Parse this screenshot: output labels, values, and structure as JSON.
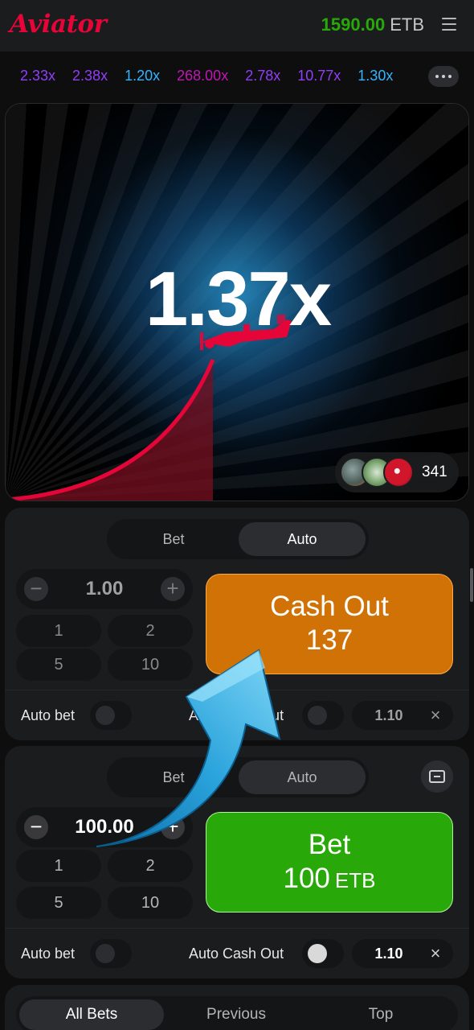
{
  "app": {
    "logo": "Aviator",
    "balance_amount": "1590.00",
    "balance_currency": "ETB"
  },
  "history": [
    "2.33x",
    "2.38x",
    "1.20x",
    "268.00x",
    "2.78x",
    "10.77x",
    "1.30x"
  ],
  "history_colors": [
    "#913ef8",
    "#913ef8",
    "#34b4ff",
    "#c017b4",
    "#913ef8",
    "#913ef8",
    "#34b4ff"
  ],
  "game": {
    "multiplier": "1.37x",
    "players_count": "341"
  },
  "panel1": {
    "tabs": [
      "Bet",
      "Auto"
    ],
    "active_tab": "Auto",
    "stake": "1.00",
    "quick_amounts": [
      "1",
      "2",
      "5",
      "10"
    ],
    "action_line1": "Cash Out",
    "action_line2": "137",
    "auto_bet_label": "Auto bet",
    "auto_cashout_label": "Auto Cash Out",
    "auto_cashout_value": "1.10"
  },
  "panel2": {
    "tabs": [
      "Bet",
      "Auto"
    ],
    "active_tab": "Auto",
    "stake": "100.00",
    "quick_amounts": [
      "1",
      "2",
      "5",
      "10"
    ],
    "action_line1": "Bet",
    "action_amount": "100",
    "action_currency": "ETB",
    "auto_bet_label": "Auto bet",
    "auto_cashout_label": "Auto Cash Out",
    "auto_cashout_value": "1.10"
  },
  "bottom_tabs": [
    "All Bets",
    "Previous",
    "Top"
  ],
  "bottom_active": "All Bets",
  "colors": {
    "brand": "#e50539",
    "balance": "#28a909",
    "cashout": "#d07206",
    "bet": "#28a909",
    "overlay_arrow": "#2aa3dc"
  }
}
